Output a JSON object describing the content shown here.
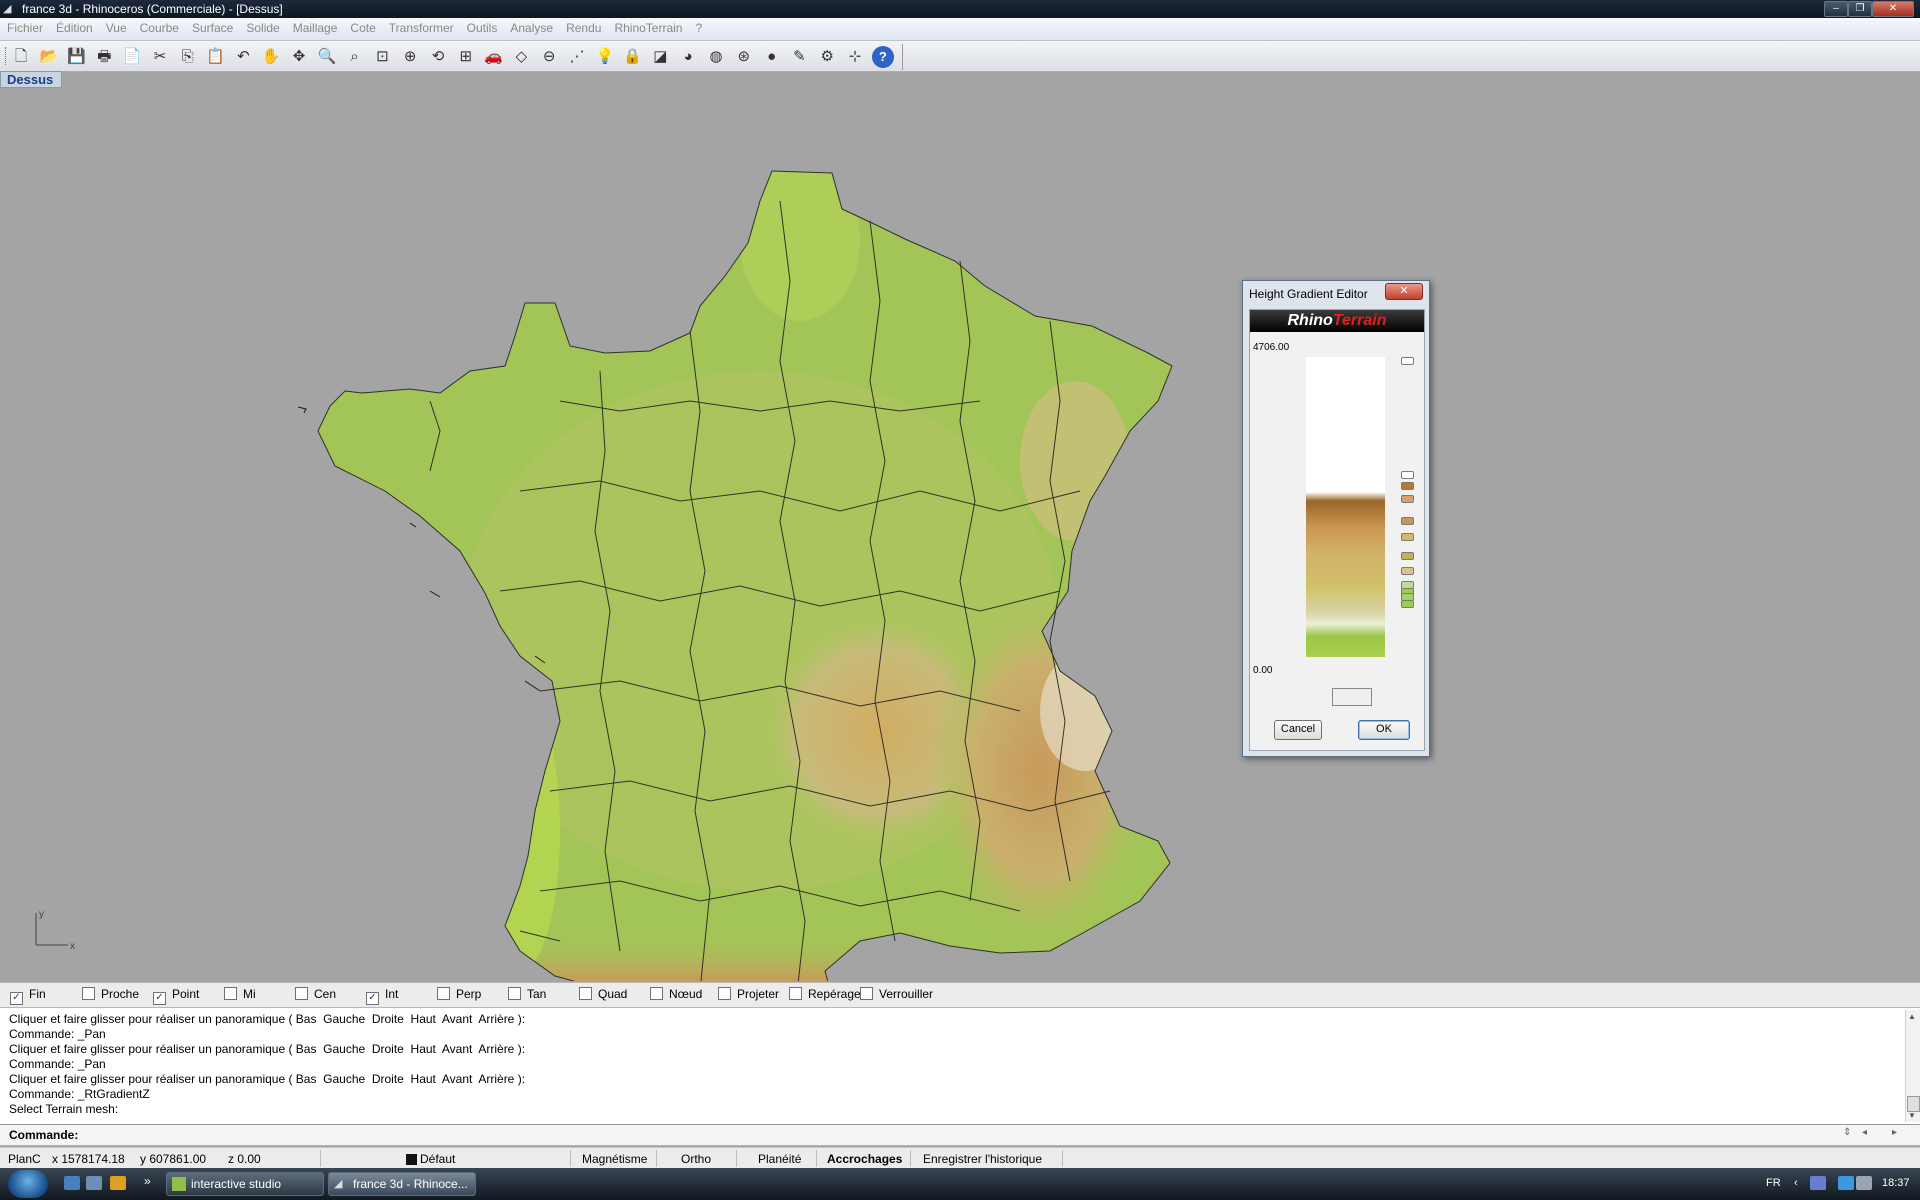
{
  "window": {
    "title": "france  3d - Rhinoceros (Commerciale) - [Dessus]",
    "min_icon": "minimize-icon",
    "max_icon": "maximize-icon",
    "close_icon": "close-icon"
  },
  "menu": [
    "Fichier",
    "Édition",
    "Vue",
    "Courbe",
    "Surface",
    "Solide",
    "Maillage",
    "Cote",
    "Transformer",
    "Outils",
    "Analyse",
    "Rendu",
    "RhinoTerrain",
    "?"
  ],
  "toolbar": [
    {
      "name": "new-file-icon",
      "glyph": "🗋"
    },
    {
      "name": "open-folder-icon",
      "glyph": "📂"
    },
    {
      "name": "save-icon",
      "glyph": "💾"
    },
    {
      "name": "print-icon",
      "glyph": "🖶"
    },
    {
      "name": "export-icon",
      "glyph": "📄"
    },
    {
      "name": "cut-icon",
      "glyph": "✂"
    },
    {
      "name": "copy-icon",
      "glyph": "⎘"
    },
    {
      "name": "paste-icon",
      "glyph": "📋"
    },
    {
      "name": "undo-icon",
      "glyph": "↶"
    },
    {
      "name": "pan-hand-icon",
      "glyph": "✋"
    },
    {
      "name": "move-icon",
      "glyph": "✥"
    },
    {
      "name": "zoom-icon",
      "glyph": "🔍"
    },
    {
      "name": "zoom-window-icon",
      "glyph": "⌕"
    },
    {
      "name": "zoom-extents-icon",
      "glyph": "⊡"
    },
    {
      "name": "zoom-selected-icon",
      "glyph": "⊕"
    },
    {
      "name": "rotate-view-icon",
      "glyph": "⟲"
    },
    {
      "name": "viewport-layout-icon",
      "glyph": "⊞"
    },
    {
      "name": "car-render-icon",
      "glyph": "🚗"
    },
    {
      "name": "plane-icon",
      "glyph": "◇"
    },
    {
      "name": "cplane-icon",
      "glyph": "⊖"
    },
    {
      "name": "select-points-icon",
      "glyph": "⋰"
    },
    {
      "name": "light-bulb-icon",
      "glyph": "💡"
    },
    {
      "name": "lock-icon",
      "glyph": "🔒"
    },
    {
      "name": "layer-icon",
      "glyph": "◪"
    },
    {
      "name": "color-wheel-icon",
      "glyph": "◕"
    },
    {
      "name": "wireframe-sphere-icon",
      "glyph": "◍"
    },
    {
      "name": "mesh-sphere-icon",
      "glyph": "⊛"
    },
    {
      "name": "render-sphere-icon",
      "glyph": "●"
    },
    {
      "name": "pen-tool-icon",
      "glyph": "✎"
    },
    {
      "name": "settings-gear-icon",
      "glyph": "⚙"
    },
    {
      "name": "grid-snap-icon",
      "glyph": "⊹"
    },
    {
      "name": "help-icon",
      "glyph": "?"
    }
  ],
  "viewport": {
    "label": "Dessus",
    "axis_y": "y",
    "axis_x": "x"
  },
  "dialog": {
    "title": "Height Gradient Editor",
    "logo_part1": "Rhino",
    "logo_part2": "Terrain",
    "max_value": "4706.00",
    "min_value": "0.00",
    "stop_colors": [
      "#ffffff",
      "#ffffff",
      "#b97a2f",
      "#d4a26a",
      "#c8965a",
      "#d9b66a",
      "#c9ac62",
      "#d6c48a",
      "#c7d89e",
      "#9ccb57",
      "#a8d25c",
      "#9fca58"
    ],
    "cancel": "Cancel",
    "ok": "OK"
  },
  "osnaps": [
    {
      "label": "Fin",
      "checked": true
    },
    {
      "label": "Proche",
      "checked": false
    },
    {
      "label": "Point",
      "checked": true
    },
    {
      "label": "Mi",
      "checked": false
    },
    {
      "label": "Cen",
      "checked": false
    },
    {
      "label": "Int",
      "checked": true
    },
    {
      "label": "Perp",
      "checked": false
    },
    {
      "label": "Tan",
      "checked": false
    },
    {
      "label": "Quad",
      "checked": false
    },
    {
      "label": "Nœud",
      "checked": false
    },
    {
      "label": "Projeter",
      "checked": false
    },
    {
      "label": "Repérage",
      "checked": false
    },
    {
      "label": "Verrouiller",
      "checked": false
    }
  ],
  "history": [
    "Cliquer et faire glisser pour réaliser un panoramique ( Bas  Gauche  Droite  Haut  Avant  Arrière ):",
    "Commande: _Pan",
    "Cliquer et faire glisser pour réaliser un panoramique ( Bas  Gauche  Droite  Haut  Avant  Arrière ):",
    "Commande: _Pan",
    "Cliquer et faire glisser pour réaliser un panoramique ( Bas  Gauche  Droite  Haut  Avant  Arrière ):",
    "Commande: _RtGradientZ",
    "Select Terrain mesh:"
  ],
  "command": {
    "label": "Commande:",
    "value": ""
  },
  "status": {
    "plane": "PlanC",
    "x": "x 1578174.18",
    "y": "y 607861.00",
    "z": "z 0.00",
    "layer": "Défaut",
    "magnetism": "Magnétisme",
    "ortho": "Ortho",
    "planarity": "Planéité",
    "osnap": "Accrochages",
    "history": "Enregistrer l'historique"
  },
  "taskbar": {
    "expand": "»",
    "task1": "interactive studio",
    "task2": "france  3d - Rhinoce...",
    "lang": "FR",
    "chevron": "‹",
    "time": "18:37"
  }
}
